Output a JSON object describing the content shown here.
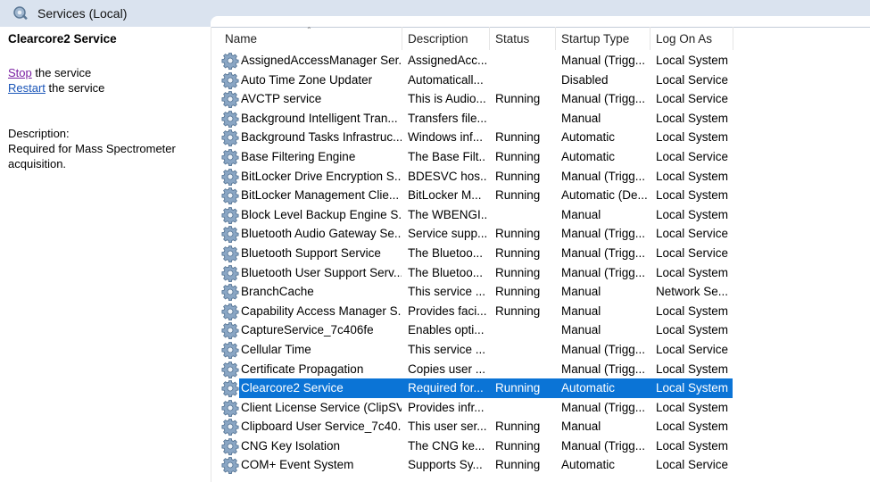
{
  "window": {
    "title": "Services (Local)"
  },
  "left_pane": {
    "service_title": "Clearcore2 Service",
    "stop_link": "Stop",
    "stop_suffix": " the service",
    "restart_link": "Restart",
    "restart_suffix": " the service",
    "description_label": "Description:",
    "description_text": "Required for Mass Spectrometer acquisition."
  },
  "columns": {
    "name": "Name",
    "description": "Description",
    "status": "Status",
    "startup_type": "Startup Type",
    "log_on_as": "Log On As"
  },
  "services": [
    {
      "name": "AssignedAccessManager Ser...",
      "description": "AssignedAcc...",
      "status": "",
      "startup": "Manual (Trigg...",
      "logon": "Local System"
    },
    {
      "name": "Auto Time Zone Updater",
      "description": "Automaticall...",
      "status": "",
      "startup": "Disabled",
      "logon": "Local Service"
    },
    {
      "name": "AVCTP service",
      "description": "This is Audio...",
      "status": "Running",
      "startup": "Manual (Trigg...",
      "logon": "Local Service"
    },
    {
      "name": "Background Intelligent Tran...",
      "description": "Transfers file...",
      "status": "",
      "startup": "Manual",
      "logon": "Local System"
    },
    {
      "name": "Background Tasks Infrastruc...",
      "description": "Windows inf...",
      "status": "Running",
      "startup": "Automatic",
      "logon": "Local System"
    },
    {
      "name": "Base Filtering Engine",
      "description": "The Base Filt...",
      "status": "Running",
      "startup": "Automatic",
      "logon": "Local Service"
    },
    {
      "name": "BitLocker Drive Encryption S...",
      "description": "BDESVC hos...",
      "status": "Running",
      "startup": "Manual (Trigg...",
      "logon": "Local System"
    },
    {
      "name": "BitLocker Management Clie...",
      "description": "BitLocker M...",
      "status": "Running",
      "startup": "Automatic (De...",
      "logon": "Local System"
    },
    {
      "name": "Block Level Backup Engine S...",
      "description": "The WBENGI...",
      "status": "",
      "startup": "Manual",
      "logon": "Local System"
    },
    {
      "name": "Bluetooth Audio Gateway Se...",
      "description": "Service supp...",
      "status": "Running",
      "startup": "Manual (Trigg...",
      "logon": "Local Service"
    },
    {
      "name": "Bluetooth Support Service",
      "description": "The Bluetoo...",
      "status": "Running",
      "startup": "Manual (Trigg...",
      "logon": "Local Service"
    },
    {
      "name": "Bluetooth User Support Serv...",
      "description": "The Bluetoo...",
      "status": "Running",
      "startup": "Manual (Trigg...",
      "logon": "Local System"
    },
    {
      "name": "BranchCache",
      "description": "This service ...",
      "status": "Running",
      "startup": "Manual",
      "logon": "Network Se..."
    },
    {
      "name": "Capability Access Manager S...",
      "description": "Provides faci...",
      "status": "Running",
      "startup": "Manual",
      "logon": "Local System"
    },
    {
      "name": "CaptureService_7c406fe",
      "description": "Enables opti...",
      "status": "",
      "startup": "Manual",
      "logon": "Local System"
    },
    {
      "name": "Cellular Time",
      "description": "This service ...",
      "status": "",
      "startup": "Manual (Trigg...",
      "logon": "Local Service"
    },
    {
      "name": "Certificate Propagation",
      "description": "Copies user ...",
      "status": "",
      "startup": "Manual (Trigg...",
      "logon": "Local System"
    },
    {
      "name": "Clearcore2 Service",
      "description": "Required for...",
      "status": "Running",
      "startup": "Automatic",
      "logon": "Local System",
      "selected": true
    },
    {
      "name": "Client License Service (ClipSV...",
      "description": "Provides infr...",
      "status": "",
      "startup": "Manual (Trigg...",
      "logon": "Local System"
    },
    {
      "name": "Clipboard User Service_7c40...",
      "description": "This user ser...",
      "status": "Running",
      "startup": "Manual",
      "logon": "Local System"
    },
    {
      "name": "CNG Key Isolation",
      "description": "The CNG ke...",
      "status": "Running",
      "startup": "Manual (Trigg...",
      "logon": "Local System"
    },
    {
      "name": "COM+ Event System",
      "description": "Supports Sy...",
      "status": "Running",
      "startup": "Automatic",
      "logon": "Local Service"
    }
  ],
  "colors": {
    "selection": "#0b74d6",
    "link": "#1a55b8",
    "titlebar": "#dae3ef"
  },
  "icons": {
    "window": "services-icon",
    "row": "gear-icon"
  }
}
